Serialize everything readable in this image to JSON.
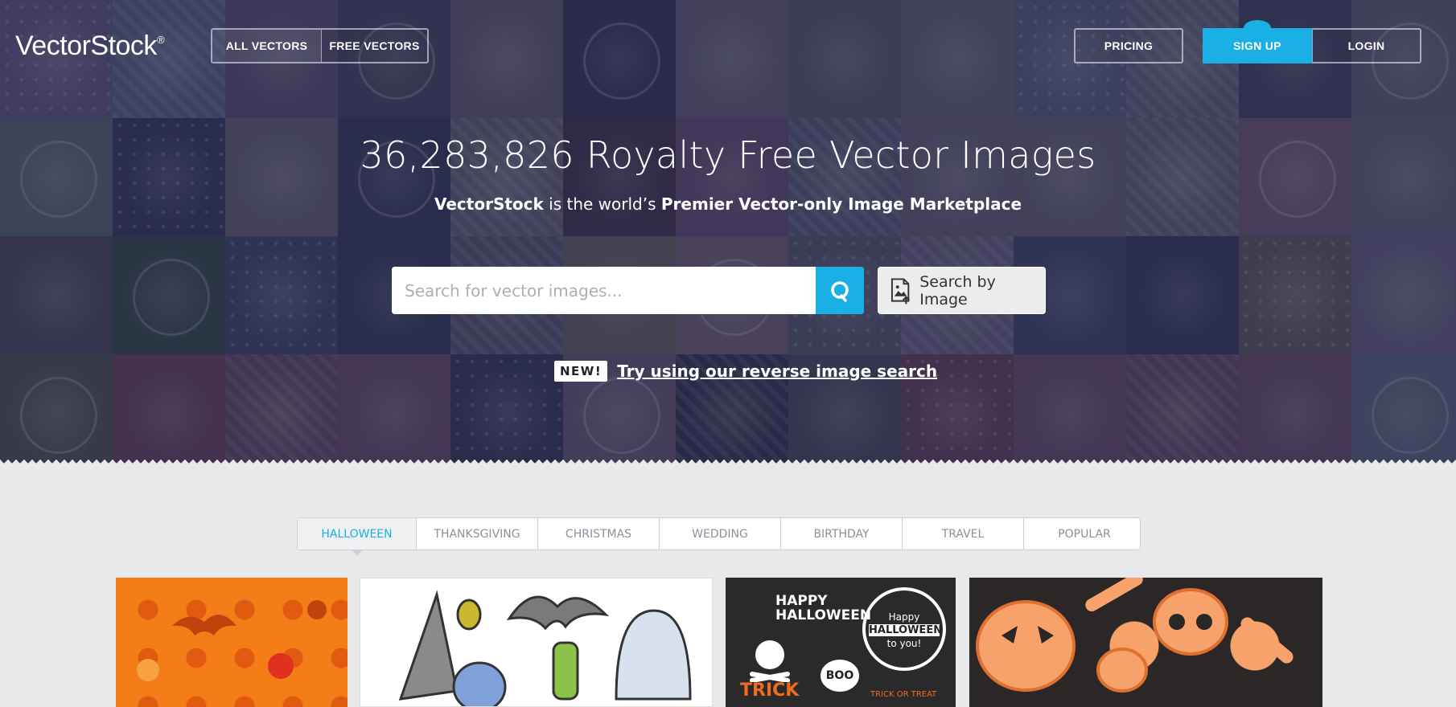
{
  "brand": {
    "logo_light": "Vector",
    "logo_bold": "Stock",
    "logo_mark": "®"
  },
  "nav": {
    "all_vectors": "ALL VECTORS",
    "free_vectors": "FREE VECTORS",
    "pricing": "PRICING",
    "sign_up": "SIGN UP",
    "login": "LOGIN"
  },
  "hero": {
    "headline": "36,283,826 Royalty Free Vector Images",
    "sub_brand": "VectorStock",
    "sub_middle": " is the world’s ",
    "sub_bold": "Premier Vector-only Image Marketplace"
  },
  "search": {
    "placeholder": "Search for vector images...",
    "by_image_label": "Search by Image"
  },
  "promo": {
    "badge": "NEW!",
    "link": "Try using our reverse image search"
  },
  "tabs": [
    "HALLOWEEN",
    "THANKSGIVING",
    "CHRISTMAS",
    "WEDDING",
    "BIRTHDAY",
    "TRAVEL",
    "POPULAR"
  ],
  "colors": {
    "accent": "#1ab0e6",
    "page_bg": "#e8e9ea",
    "orange": "#f47d18"
  },
  "gallery": {
    "halloween_text": "HAPPY HALLOWEEN",
    "trick_text": "TRICK",
    "treat_text": "TRICK OR TREAT",
    "boo_text": "BOO",
    "badge_happy": "Happy",
    "badge_main": "HALLOWEEN",
    "badge_sub": "to you!"
  }
}
